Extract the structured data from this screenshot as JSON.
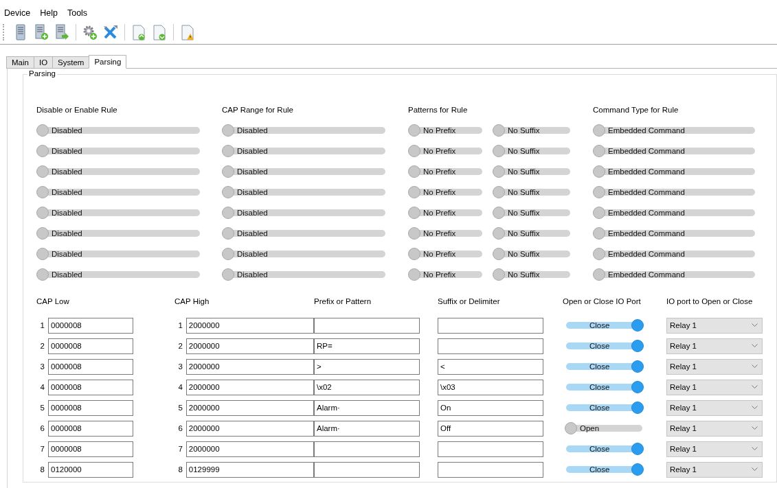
{
  "menu": [
    "Device",
    "Help",
    "Tools"
  ],
  "tabs": [
    {
      "label": "Main",
      "selected": false
    },
    {
      "label": "IO",
      "selected": false
    },
    {
      "label": "System",
      "selected": false
    },
    {
      "label": "Parsing",
      "selected": true
    }
  ],
  "group_title": "Parsing",
  "rule_headers": [
    "Disable or Enable Rule",
    "CAP Range for Rule",
    "Patterns for Rule",
    "Command Type for Rule"
  ],
  "rules": [
    {
      "enable": {
        "label": "Disabled",
        "on": false
      },
      "cap_range": {
        "label": "Disabled",
        "on": false
      },
      "prefix": {
        "label": "No Prefix",
        "on": false
      },
      "suffix": {
        "label": "No Suffix",
        "on": false
      },
      "command_type": {
        "label": "Embedded Command",
        "on": false
      }
    },
    {
      "enable": {
        "label": "Disabled",
        "on": false
      },
      "cap_range": {
        "label": "Disabled",
        "on": false
      },
      "prefix": {
        "label": "No Prefix",
        "on": false
      },
      "suffix": {
        "label": "No Suffix",
        "on": false
      },
      "command_type": {
        "label": "Embedded Command",
        "on": false
      }
    },
    {
      "enable": {
        "label": "Disabled",
        "on": false
      },
      "cap_range": {
        "label": "Disabled",
        "on": false
      },
      "prefix": {
        "label": "No Prefix",
        "on": false
      },
      "suffix": {
        "label": "No Suffix",
        "on": false
      },
      "command_type": {
        "label": "Embedded Command",
        "on": false
      }
    },
    {
      "enable": {
        "label": "Disabled",
        "on": false
      },
      "cap_range": {
        "label": "Disabled",
        "on": false
      },
      "prefix": {
        "label": "No Prefix",
        "on": false
      },
      "suffix": {
        "label": "No Suffix",
        "on": false
      },
      "command_type": {
        "label": "Embedded Command",
        "on": false
      }
    },
    {
      "enable": {
        "label": "Disabled",
        "on": false
      },
      "cap_range": {
        "label": "Disabled",
        "on": false
      },
      "prefix": {
        "label": "No Prefix",
        "on": false
      },
      "suffix": {
        "label": "No Suffix",
        "on": false
      },
      "command_type": {
        "label": "Embedded Command",
        "on": false
      }
    },
    {
      "enable": {
        "label": "Disabled",
        "on": false
      },
      "cap_range": {
        "label": "Disabled",
        "on": false
      },
      "prefix": {
        "label": "No Prefix",
        "on": false
      },
      "suffix": {
        "label": "No Suffix",
        "on": false
      },
      "command_type": {
        "label": "Embedded Command",
        "on": false
      }
    },
    {
      "enable": {
        "label": "Disabled",
        "on": false
      },
      "cap_range": {
        "label": "Disabled",
        "on": false
      },
      "prefix": {
        "label": "No Prefix",
        "on": false
      },
      "suffix": {
        "label": "No Suffix",
        "on": false
      },
      "command_type": {
        "label": "Embedded Command",
        "on": false
      }
    },
    {
      "enable": {
        "label": "Disabled",
        "on": false
      },
      "cap_range": {
        "label": "Disabled",
        "on": false
      },
      "prefix": {
        "label": "No Prefix",
        "on": false
      },
      "suffix": {
        "label": "No Suffix",
        "on": false
      },
      "command_type": {
        "label": "Embedded Command",
        "on": false
      }
    }
  ],
  "detail_headers": [
    "CAP Low",
    "CAP High",
    "Prefix or Pattern",
    "Suffix or Delimiter",
    "Open or Close IO Port",
    "IO port to Open or Close"
  ],
  "details": [
    {
      "low_index": "1",
      "cap_low": "0000008",
      "high_index": "1",
      "cap_high": "2000000",
      "port_action": {
        "label": "Close",
        "on": true
      },
      "io_port": "Relay 1"
    },
    {
      "low_index": "2",
      "cap_low": "0000008",
      "high_index": "2",
      "cap_high": "2000000",
      "prefix": "RP=",
      "port_action": {
        "label": "Close",
        "on": true
      },
      "io_port": "Relay 1"
    },
    {
      "low_index": "3",
      "cap_low": "0000008",
      "high_index": "3",
      "cap_high": "2000000",
      "prefix": ">",
      "suffix": "<",
      "port_action": {
        "label": "Close",
        "on": true
      },
      "io_port": "Relay 1"
    },
    {
      "low_index": "4",
      "cap_low": "0000008",
      "high_index": "4",
      "cap_high": "2000000",
      "prefix": "\\x02",
      "suffix": "\\x03",
      "port_action": {
        "label": "Close",
        "on": true
      },
      "io_port": "Relay 1"
    },
    {
      "low_index": "5",
      "cap_low": "0000008",
      "high_index": "5",
      "cap_high": "2000000",
      "prefix": "Alarm·",
      "suffix": "On",
      "port_action": {
        "label": "Close",
        "on": true
      },
      "io_port": "Relay 1"
    },
    {
      "low_index": "6",
      "cap_low": "0000008",
      "high_index": "6",
      "cap_high": "2000000",
      "prefix": "Alarm·",
      "suffix": "Off",
      "port_action": {
        "label": "Open",
        "on": false
      },
      "io_port": "Relay 1"
    },
    {
      "low_index": "7",
      "cap_low": "0000008",
      "high_index": "7",
      "cap_high": "2000000",
      "port_action": {
        "label": "Close",
        "on": true
      },
      "io_port": "Relay 1"
    },
    {
      "low_index": "8",
      "cap_low": "0120000",
      "high_index": "8",
      "cap_high": "0129999",
      "port_action": {
        "label": "Close",
        "on": true
      },
      "io_port": "Relay 1"
    }
  ]
}
